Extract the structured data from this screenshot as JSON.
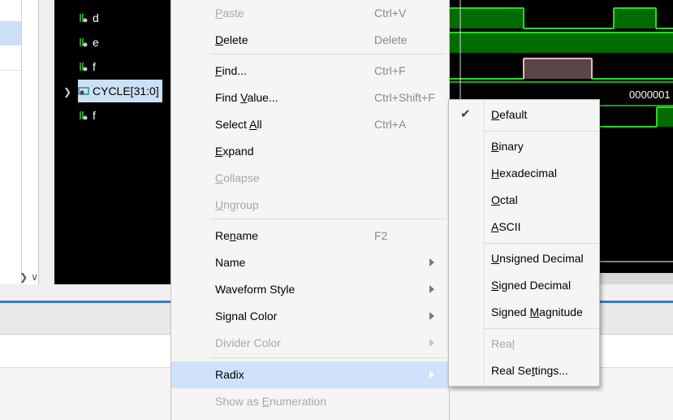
{
  "signals": [
    {
      "name": "d",
      "type": "bit"
    },
    {
      "name": "e",
      "type": "bit"
    },
    {
      "name": "f",
      "type": "bit"
    },
    {
      "name": "CYCLE[31:0]",
      "type": "bus",
      "selected": true
    },
    {
      "name": "f",
      "type": "bit"
    }
  ],
  "waveform": {
    "bus_value": "0000001",
    "colors": {
      "green": "#006b00",
      "edge": "#23d923",
      "pink": "#5c4548",
      "pink_edge": "#e6b9b9",
      "cursor": "#ffffff"
    }
  },
  "context_menu": {
    "items": [
      {
        "label": "Paste",
        "mnemonic": "P",
        "shortcut": "Ctrl+V",
        "enabled": false,
        "submenu": false
      },
      {
        "label": "Delete",
        "mnemonic": "D",
        "shortcut": "Delete",
        "enabled": true,
        "submenu": false
      },
      {
        "label": "Find...",
        "mnemonic": "F",
        "shortcut": "Ctrl+F",
        "enabled": true,
        "submenu": false
      },
      {
        "label": "Find Value...",
        "mnemonic": "V",
        "shortcut": "Ctrl+Shift+F",
        "enabled": true,
        "submenu": false
      },
      {
        "label": "Select All",
        "mnemonic": "A",
        "shortcut": "Ctrl+A",
        "enabled": true,
        "submenu": false
      },
      {
        "label": "Expand",
        "mnemonic": "E",
        "shortcut": "",
        "enabled": true,
        "submenu": false
      },
      {
        "label": "Collapse",
        "mnemonic": "C",
        "shortcut": "",
        "enabled": false,
        "submenu": false
      },
      {
        "label": "Ungroup",
        "mnemonic": "U",
        "shortcut": "",
        "enabled": false,
        "submenu": false
      },
      {
        "label": "Rename",
        "mnemonic": "n",
        "shortcut": "F2",
        "enabled": true,
        "submenu": false
      },
      {
        "label": "Name",
        "mnemonic": "",
        "shortcut": "",
        "enabled": true,
        "submenu": true
      },
      {
        "label": "Waveform Style",
        "mnemonic": "",
        "shortcut": "",
        "enabled": true,
        "submenu": true
      },
      {
        "label": "Signal Color",
        "mnemonic": "",
        "shortcut": "",
        "enabled": true,
        "submenu": true
      },
      {
        "label": "Divider Color",
        "mnemonic": "",
        "shortcut": "",
        "enabled": false,
        "submenu": true
      },
      {
        "label": "Radix",
        "mnemonic": "",
        "shortcut": "",
        "enabled": true,
        "submenu": true,
        "highlighted": true
      },
      {
        "label": "Show as Enumeration",
        "mnemonic": "E",
        "shortcut": "",
        "enabled": false,
        "submenu": false
      }
    ]
  },
  "radix_submenu": {
    "items": [
      {
        "label": "Default",
        "mnemonic": "D",
        "enabled": true,
        "checked": true
      },
      {
        "label": "Binary",
        "mnemonic": "B",
        "enabled": true,
        "checked": false
      },
      {
        "label": "Hexadecimal",
        "mnemonic": "H",
        "enabled": true,
        "checked": false
      },
      {
        "label": "Octal",
        "mnemonic": "O",
        "enabled": true,
        "checked": false
      },
      {
        "label": "ASCII",
        "mnemonic": "A",
        "enabled": true,
        "checked": false
      },
      {
        "label": "Unsigned Decimal",
        "mnemonic": "U",
        "enabled": true,
        "checked": false
      },
      {
        "label": "Signed Decimal",
        "mnemonic": "S",
        "enabled": true,
        "checked": false
      },
      {
        "label": "Signed Magnitude",
        "mnemonic": "M",
        "enabled": true,
        "checked": false
      },
      {
        "label": "Real",
        "mnemonic": "l",
        "enabled": false,
        "checked": false
      },
      {
        "label": "Real Settings...",
        "mnemonic": "t",
        "enabled": true,
        "checked": false
      }
    ]
  },
  "theme": {
    "selection": "#cce0f5",
    "highlight": "#cfe1fb",
    "accent": "#3c78c8"
  }
}
